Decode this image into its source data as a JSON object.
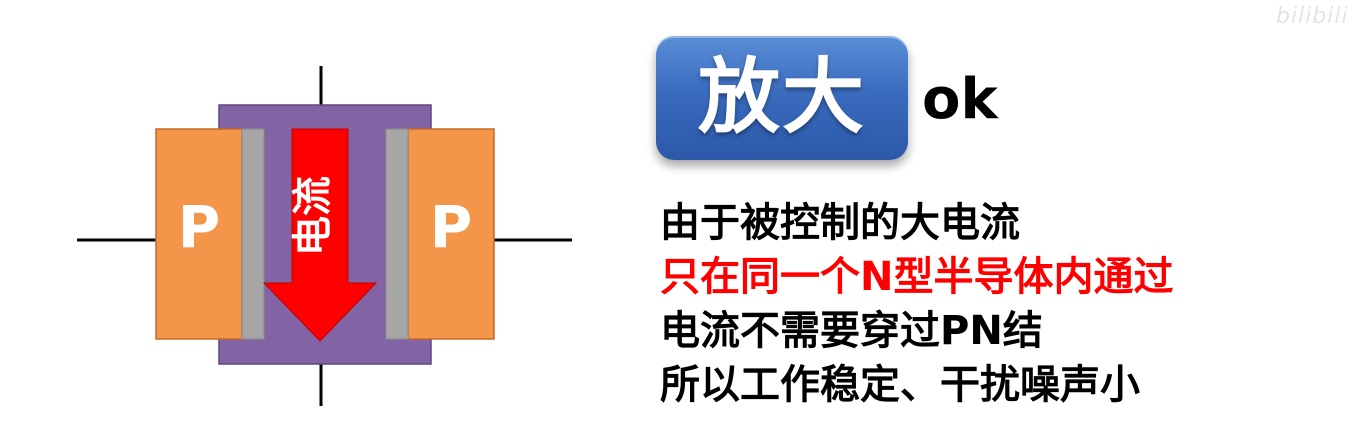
{
  "diagram": {
    "left_region_label": "P",
    "right_region_label": "P",
    "current_label": "电流",
    "colors": {
      "p_region": "#f4964a",
      "n_channel": "#8264a4",
      "depletion": "#a6a6a6",
      "arrow": "#ff0000",
      "lead": "#000000"
    }
  },
  "badge": {
    "text": "放大",
    "color": "#3a6cbf"
  },
  "status": {
    "text": "ok"
  },
  "explanation": {
    "lines": [
      "由于被控制的大电流",
      "只在同一个N型半导体内通过",
      "电流不需要穿过PN结",
      "所以工作稳定、干扰噪声小"
    ],
    "highlight_color": "#ff0000"
  },
  "watermark": {
    "text": "bilibili"
  }
}
